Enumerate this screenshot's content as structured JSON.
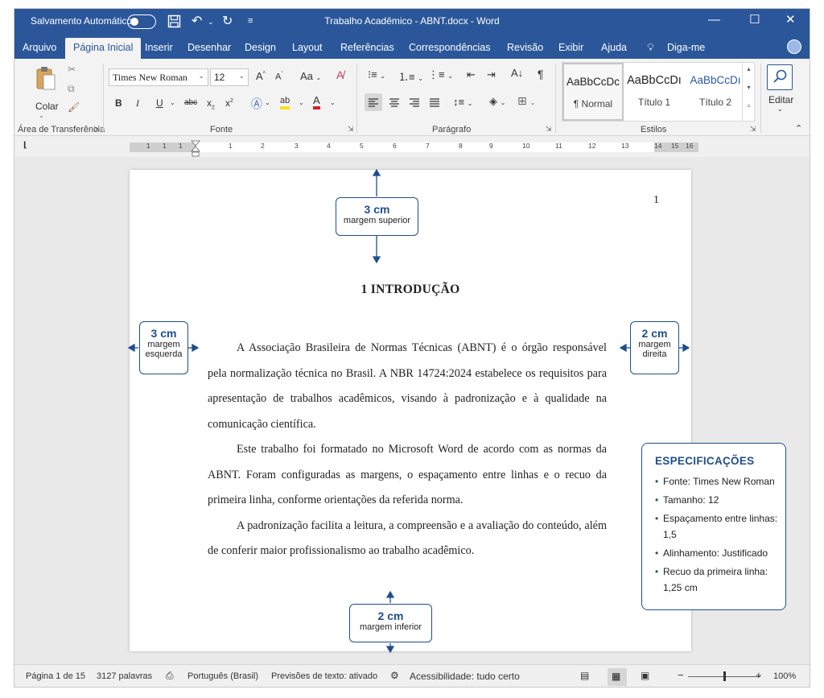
{
  "titlebar": {
    "autosave_label": "Salvamento Automático",
    "doc_title": "Trabalho Acadêmico - ABNT.docx - Word"
  },
  "tabs": [
    "Arquivo",
    "Página Inicial",
    "Inserir",
    "Desenhar",
    "Design",
    "Layout",
    "Referências",
    "Correspondências",
    "Revisão",
    "Exibir",
    "Ajuda",
    "Diga-me"
  ],
  "ribbon": {
    "clipboard": {
      "paste_label": "Colar",
      "group_label": "Área de Transferência"
    },
    "font": {
      "family": "Times New Roman",
      "size": "12",
      "group_label": "Fonte"
    },
    "paragraph": {
      "group_label": "Parágrafo"
    },
    "styles": {
      "group_label": "Estilos",
      "items": [
        {
          "preview": "AaBbCcDc",
          "name": "¶ Normal"
        },
        {
          "preview": "AaBbCcDı",
          "name": "Título 1"
        },
        {
          "preview": "AaBbCcDı",
          "name": "Título 2"
        }
      ],
      "accent": "#2b579a"
    },
    "editing": {
      "label": "Editar"
    }
  },
  "ruler_h": [
    "1",
    "1",
    "1",
    "1",
    "2",
    "3",
    "4",
    "5",
    "6",
    "7",
    "8",
    "9",
    "10",
    "11",
    "12",
    "13",
    "14",
    "15",
    "16"
  ],
  "ruler_v": [
    "1",
    "1",
    "1",
    "2",
    "3",
    "4",
    "5",
    "6",
    "7",
    "8",
    "9",
    "10",
    "11",
    "12",
    "13"
  ],
  "document": {
    "page_number": "1",
    "heading": "1   INTRODUÇÃO",
    "paragraphs": [
      "A Associação Brasileira de Normas Técnicas (ABNT) é o órgão responsável pela normalização técnica no Brasil. A NBR 14724:2024 estabelece os requisitos para apresentação de trabalhos acadêmicos, visando à padronização e à qualidade na comunicação científica.",
      "Este trabalho foi formatado no Microsoft Word de acordo com as normas da ABNT. Foram configuradas as margens, o espaçamento entre linhas e o recuo da primeira linha, conforme orientações da referida norma.",
      "A padronização facilita a leitura, a compreensão e a avaliação do conteúdo, além de conferir maior profissionalismo ao trabalho acadêmico."
    ]
  },
  "callouts": {
    "top": {
      "value": "3 cm",
      "label": "margem superior"
    },
    "left": {
      "value": "3 cm",
      "label_1": "margem",
      "label_2": "esquerda"
    },
    "right": {
      "value": "2 cm",
      "label_1": "margem",
      "label_2": "direita"
    },
    "bottom": {
      "value": "2 cm",
      "label": "margem inferior"
    },
    "accent": "#1f4e8c"
  },
  "specs": {
    "title": "ESPECIFICAÇÕES",
    "items": [
      "Fonte: Times New Roman",
      "Tamanho: 12",
      "Espaçamento entre linhas: 1,5",
      "Alinhamento: Justificado",
      "Recuo da primeira linha: 1,25 cm"
    ]
  },
  "status": {
    "page": "Página 1 de 15",
    "words": "3127 palavras",
    "language": "Português (Brasil)",
    "predictions": "Previsões de texto: ativado",
    "accessibility": "Acessibilidade: tudo certo",
    "zoom": "100%",
    "zoom_fraction": 0.5
  }
}
